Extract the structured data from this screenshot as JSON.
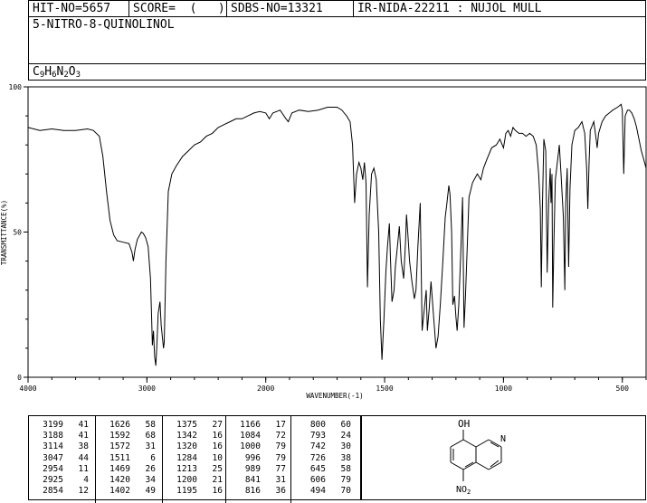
{
  "header": {
    "hit_no": "HIT-NO=5657",
    "score": "SCORE=  (   )",
    "sdbs_no": "SDBS-NO=13321",
    "ir_info": "IR-NIDA-22211 : NUJOL MULL"
  },
  "compound": {
    "name": "5-NITRO-8-QUINOLINOL",
    "formula_parts": [
      {
        "t": "C",
        "sub": false
      },
      {
        "t": "9",
        "sub": true
      },
      {
        "t": "H",
        "sub": false
      },
      {
        "t": "6",
        "sub": true
      },
      {
        "t": "N",
        "sub": false
      },
      {
        "t": "2",
        "sub": true
      },
      {
        "t": "O",
        "sub": false
      },
      {
        "t": "3",
        "sub": true
      }
    ]
  },
  "chart_data": {
    "type": "line",
    "title": "",
    "xlabel": "WAVENUMBER(-1)",
    "ylabel": "TRANSMITTANCE(%)",
    "xlim": [
      4000,
      400
    ],
    "ylim": [
      0,
      100
    ],
    "xticks": [
      4000,
      3000,
      2000,
      1500,
      1000,
      500
    ],
    "yticks": [
      0,
      50,
      100
    ],
    "grid": false,
    "series": [
      {
        "points": [
          [
            4000,
            86
          ],
          [
            3900,
            85
          ],
          [
            3800,
            85.5
          ],
          [
            3700,
            85
          ],
          [
            3600,
            85
          ],
          [
            3500,
            85.5
          ],
          [
            3450,
            85
          ],
          [
            3400,
            83
          ],
          [
            3370,
            76
          ],
          [
            3340,
            64
          ],
          [
            3310,
            54
          ],
          [
            3280,
            49
          ],
          [
            3250,
            47
          ],
          [
            3200,
            46.5
          ],
          [
            3150,
            46
          ],
          [
            3125,
            43
          ],
          [
            3114,
            40
          ],
          [
            3100,
            44
          ],
          [
            3080,
            47.5
          ],
          [
            3060,
            49
          ],
          [
            3047,
            50
          ],
          [
            3030,
            49.5
          ],
          [
            3010,
            48
          ],
          [
            2990,
            45
          ],
          [
            2970,
            34
          ],
          [
            2960,
            20
          ],
          [
            2954,
            11
          ],
          [
            2945,
            16
          ],
          [
            2935,
            7
          ],
          [
            2925,
            4
          ],
          [
            2915,
            12
          ],
          [
            2905,
            22
          ],
          [
            2890,
            26
          ],
          [
            2880,
            18
          ],
          [
            2870,
            14
          ],
          [
            2860,
            10
          ],
          [
            2854,
            12
          ],
          [
            2840,
            40
          ],
          [
            2820,
            64
          ],
          [
            2790,
            70
          ],
          [
            2750,
            73
          ],
          [
            2700,
            76
          ],
          [
            2650,
            78
          ],
          [
            2600,
            80
          ],
          [
            2550,
            81
          ],
          [
            2500,
            83
          ],
          [
            2450,
            84
          ],
          [
            2400,
            86
          ],
          [
            2350,
            87
          ],
          [
            2300,
            88
          ],
          [
            2250,
            89
          ],
          [
            2200,
            89
          ],
          [
            2150,
            90
          ],
          [
            2100,
            91
          ],
          [
            2050,
            91.5
          ],
          [
            2000,
            91
          ],
          [
            1985,
            89
          ],
          [
            1970,
            91
          ],
          [
            1940,
            92
          ],
          [
            1915,
            89
          ],
          [
            1905,
            88
          ],
          [
            1890,
            91
          ],
          [
            1860,
            92
          ],
          [
            1820,
            91.5
          ],
          [
            1780,
            92
          ],
          [
            1740,
            93
          ],
          [
            1700,
            93
          ],
          [
            1680,
            92
          ],
          [
            1660,
            90
          ],
          [
            1645,
            88
          ],
          [
            1635,
            80
          ],
          [
            1626,
            60
          ],
          [
            1618,
            70
          ],
          [
            1608,
            74
          ],
          [
            1600,
            72
          ],
          [
            1592,
            68
          ],
          [
            1585,
            74
          ],
          [
            1578,
            67
          ],
          [
            1572,
            31
          ],
          [
            1565,
            56
          ],
          [
            1555,
            70
          ],
          [
            1545,
            72
          ],
          [
            1535,
            68
          ],
          [
            1525,
            50
          ],
          [
            1518,
            20
          ],
          [
            1511,
            6
          ],
          [
            1503,
            20
          ],
          [
            1495,
            36
          ],
          [
            1488,
            45
          ],
          [
            1480,
            53
          ],
          [
            1475,
            40
          ],
          [
            1469,
            26
          ],
          [
            1460,
            30
          ],
          [
            1455,
            38
          ],
          [
            1445,
            46
          ],
          [
            1438,
            52
          ],
          [
            1430,
            40
          ],
          [
            1420,
            34
          ],
          [
            1412,
            47
          ],
          [
            1408,
            56
          ],
          [
            1402,
            49
          ],
          [
            1395,
            40
          ],
          [
            1385,
            33
          ],
          [
            1375,
            27
          ],
          [
            1368,
            30
          ],
          [
            1360,
            45
          ],
          [
            1350,
            60
          ],
          [
            1342,
            16
          ],
          [
            1335,
            22
          ],
          [
            1325,
            30
          ],
          [
            1320,
            16
          ],
          [
            1312,
            24
          ],
          [
            1305,
            33
          ],
          [
            1295,
            22
          ],
          [
            1284,
            10
          ],
          [
            1275,
            14
          ],
          [
            1265,
            26
          ],
          [
            1255,
            40
          ],
          [
            1245,
            55
          ],
          [
            1238,
            60
          ],
          [
            1230,
            66
          ],
          [
            1225,
            63
          ],
          [
            1218,
            50
          ],
          [
            1213,
            25
          ],
          [
            1206,
            28
          ],
          [
            1200,
            21
          ],
          [
            1195,
            16
          ],
          [
            1188,
            25
          ],
          [
            1180,
            42
          ],
          [
            1172,
            62
          ],
          [
            1166,
            17
          ],
          [
            1160,
            28
          ],
          [
            1145,
            62
          ],
          [
            1130,
            67
          ],
          [
            1110,
            70
          ],
          [
            1095,
            68
          ],
          [
            1084,
            72
          ],
          [
            1070,
            75
          ],
          [
            1050,
            79
          ],
          [
            1030,
            80
          ],
          [
            1015,
            82
          ],
          [
            1000,
            79
          ],
          [
            990,
            84
          ],
          [
            980,
            85
          ],
          [
            970,
            83
          ],
          [
            960,
            86
          ],
          [
            950,
            85
          ],
          [
            935,
            84
          ],
          [
            920,
            84
          ],
          [
            905,
            83
          ],
          [
            890,
            84
          ],
          [
            875,
            83
          ],
          [
            862,
            80
          ],
          [
            852,
            70
          ],
          [
            845,
            58
          ],
          [
            841,
            31
          ],
          [
            836,
            60
          ],
          [
            830,
            82
          ],
          [
            822,
            78
          ],
          [
            816,
            36
          ],
          [
            810,
            60
          ],
          [
            803,
            72
          ],
          [
            800,
            60
          ],
          [
            796,
            70
          ],
          [
            793,
            24
          ],
          [
            788,
            46
          ],
          [
            782,
            68
          ],
          [
            772,
            75
          ],
          [
            765,
            80
          ],
          [
            758,
            70
          ],
          [
            748,
            55
          ],
          [
            742,
            30
          ],
          [
            738,
            60
          ],
          [
            732,
            72
          ],
          [
            726,
            38
          ],
          [
            720,
            65
          ],
          [
            712,
            80
          ],
          [
            700,
            85
          ],
          [
            685,
            86
          ],
          [
            670,
            88
          ],
          [
            658,
            84
          ],
          [
            650,
            72
          ],
          [
            645,
            58
          ],
          [
            640,
            74
          ],
          [
            635,
            85
          ],
          [
            620,
            88
          ],
          [
            610,
            82
          ],
          [
            606,
            79
          ],
          [
            600,
            84
          ],
          [
            585,
            88
          ],
          [
            570,
            90
          ],
          [
            555,
            91
          ],
          [
            540,
            92
          ],
          [
            520,
            93
          ],
          [
            505,
            94
          ],
          [
            500,
            92
          ],
          [
            494,
            70
          ],
          [
            488,
            90
          ],
          [
            478,
            92
          ],
          [
            470,
            92
          ],
          [
            460,
            91
          ],
          [
            450,
            89
          ],
          [
            440,
            86
          ],
          [
            430,
            82
          ],
          [
            420,
            78
          ],
          [
            410,
            75
          ],
          [
            400,
            72
          ]
        ]
      }
    ]
  },
  "peak_table": [
    [
      [
        3199,
        41
      ],
      [
        3188,
        41
      ],
      [
        3114,
        38
      ],
      [
        3047,
        44
      ],
      [
        2954,
        11
      ],
      [
        2925,
        4
      ],
      [
        2854,
        12
      ]
    ],
    [
      [
        1626,
        58
      ],
      [
        1592,
        68
      ],
      [
        1572,
        31
      ],
      [
        1511,
        6
      ],
      [
        1469,
        26
      ],
      [
        1420,
        34
      ],
      [
        1402,
        49
      ]
    ],
    [
      [
        1375,
        27
      ],
      [
        1342,
        16
      ],
      [
        1320,
        16
      ],
      [
        1284,
        10
      ],
      [
        1213,
        25
      ],
      [
        1200,
        21
      ],
      [
        1195,
        16
      ]
    ],
    [
      [
        1166,
        17
      ],
      [
        1084,
        72
      ],
      [
        1000,
        79
      ],
      [
        996,
        79
      ],
      [
        989,
        77
      ],
      [
        841,
        31
      ],
      [
        816,
        36
      ]
    ],
    [
      [
        800,
        60
      ],
      [
        793,
        24
      ],
      [
        742,
        30
      ],
      [
        726,
        38
      ],
      [
        645,
        58
      ],
      [
        606,
        79
      ],
      [
        494,
        70
      ]
    ]
  ],
  "structure": {
    "oh_label": "OH",
    "n_label": "N",
    "no2_label": "NO2"
  }
}
